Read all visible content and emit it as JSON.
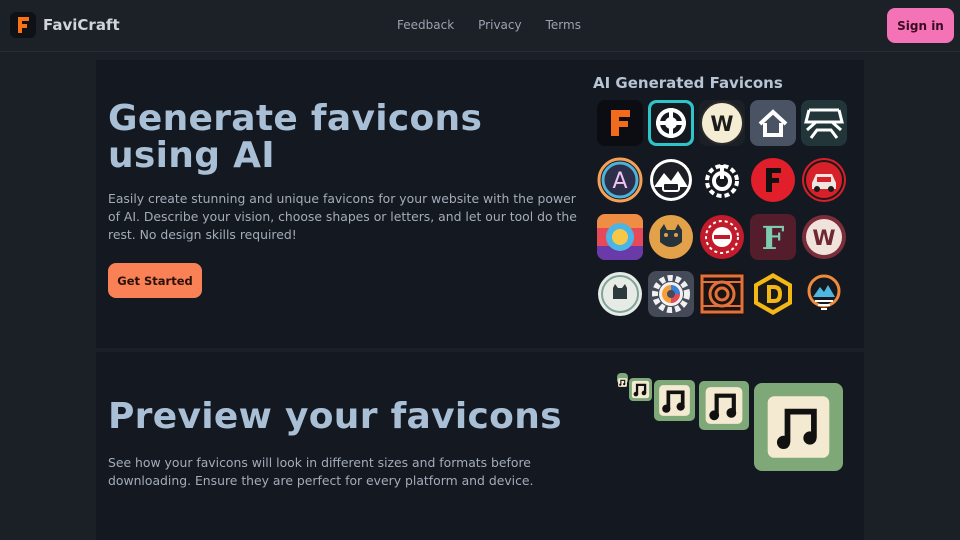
{
  "nav": {
    "brand": "FaviCraft",
    "links": [
      "Feedback",
      "Privacy",
      "Terms"
    ],
    "signin_label": "Sign in",
    "logo_icon": "letter-f-icon"
  },
  "hero": {
    "title": "Generate favicons using AI",
    "description": "Easily create stunning and unique favicons for your website with the power of AI. Describe your vision, choose shapes or letters, and let our tool do the rest. No design skills required!",
    "cta_label": "Get Started",
    "gallery_title": "AI Generated Favicons",
    "gallery_icons": [
      "orange-f-icon",
      "lifebuoy-icon",
      "letter-w-icon",
      "house-icon",
      "road-icon",
      "letter-a-ring-icon",
      "mountain-car-icon",
      "power-gauge-icon",
      "red-f-circle-icon",
      "red-car-icon",
      "colorful-circle-icon",
      "cat-icon",
      "red-target-icon",
      "teal-f-icon",
      "pink-w-icon",
      "cat-badge-icon",
      "gear-icon",
      "orange-concentric-icon",
      "letter-d-hexagon-icon",
      "shield-mountain-icon"
    ]
  },
  "preview": {
    "title": "Preview your favicons",
    "description": "See how your favicons will look in different sizes and formats before downloading. Ensure they are perfect for every platform and device.",
    "icon": "music-note-icon",
    "accent": "#7fa878"
  },
  "colors": {
    "signin_bg": "#f472b6",
    "cta_bg": "#f98155",
    "page_bg": "#1b1f26"
  }
}
